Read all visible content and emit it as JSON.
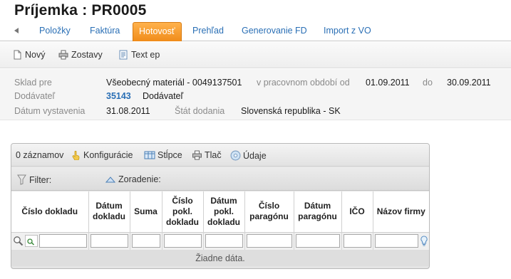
{
  "title": "Príjemka :  PR0005",
  "tabs": [
    {
      "label": "Položky"
    },
    {
      "label": "Faktúra"
    },
    {
      "label": "Hotovosť"
    },
    {
      "label": "Prehľad"
    },
    {
      "label": "Generovanie FD"
    },
    {
      "label": "Import z VO"
    }
  ],
  "toolbar": {
    "new_label": "Nový",
    "reports_label": "Zostavy",
    "text_label": "Text ep"
  },
  "info": {
    "warehouse_label": "Sklad pre",
    "warehouse_value": "Všeobecný materiál - 0049137501",
    "period_label": "v pracovnom období od",
    "period_from": "01.09.2011",
    "period_to_label": "do",
    "period_to": "30.09.2011",
    "supplier_label": "Dodávateľ",
    "supplier_code": "35143",
    "supplier_name": "Dodávateľ",
    "issue_date_label": "Dátum vystavenia",
    "issue_date": "31.08.2011",
    "country_label": "Štát dodania",
    "country_value": "Slovenská republika - SK"
  },
  "grid": {
    "records": "0 záznamov",
    "config_label": "Konfigurácie",
    "columns_label": "Stĺpce",
    "print_label": "Tlač",
    "data_label": "Údaje",
    "filter_label": "Filter:",
    "sort_label": "Zoradenie:",
    "headers": [
      "Číslo dokladu",
      "Dátum dokladu",
      "Suma",
      "Číslo pokl. dokladu",
      "Dátum pokl. dokladu",
      "Číslo paragónu",
      "Dátum paragónu",
      "IČO",
      "Názov firmy"
    ],
    "empty_text": "Žiadne dáta."
  },
  "icons": [
    "back-arrow-icon",
    "new-doc-icon",
    "printer-icon",
    "text-doc-icon",
    "hand-pointer-icon",
    "columns-icon",
    "data-disk-icon",
    "funnel-icon",
    "sort-triangle-icon",
    "magnifier-icon",
    "clear-filter-icon",
    "lightbulb-icon"
  ],
  "colors": {
    "accent": "#f59a26",
    "link": "#2a6fb5"
  }
}
